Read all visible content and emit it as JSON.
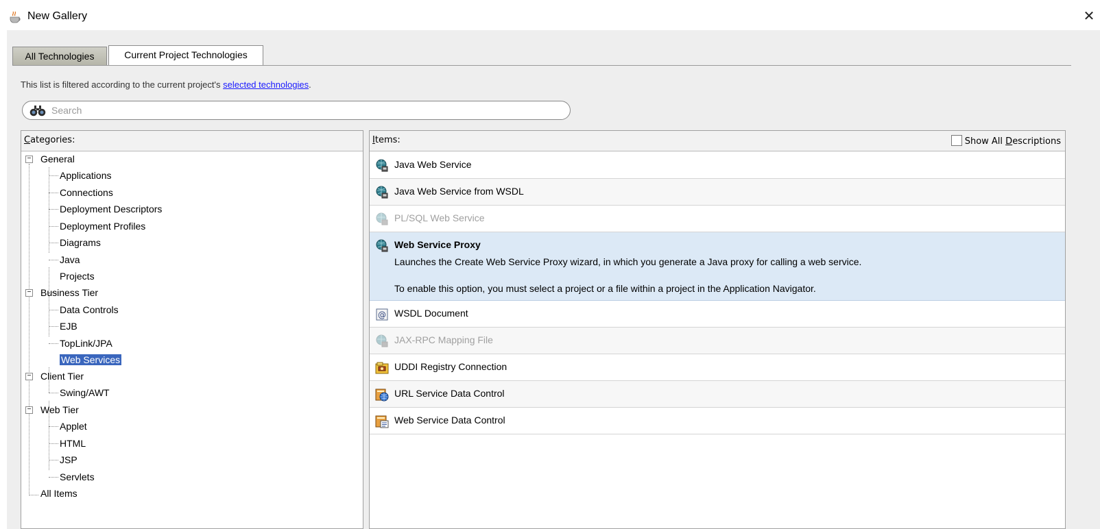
{
  "window": {
    "title": "New Gallery",
    "close_glyph": "✕",
    "app_icon": "java-cup-icon"
  },
  "tabs": [
    {
      "label": "All Technologies",
      "active": false
    },
    {
      "label": "Current Project Technologies",
      "active": true
    }
  ],
  "filter": {
    "text": "This list is filtered according to the current project's ",
    "link": "selected technologies",
    "suffix": "."
  },
  "search": {
    "placeholder": "Search",
    "value": "",
    "icon": "binoculars-icon"
  },
  "categories": {
    "header_first": "C",
    "header_rest": "ategories:",
    "groups": [
      {
        "label": "General",
        "children": [
          "Applications",
          "Connections",
          "Deployment Descriptors",
          "Deployment Profiles",
          "Diagrams",
          "Java",
          "Projects"
        ]
      },
      {
        "label": "Business Tier",
        "children": [
          "Data Controls",
          "EJB",
          "TopLink/JPA",
          "Web Services"
        ]
      },
      {
        "label": "Client Tier",
        "children": [
          "Swing/AWT"
        ]
      },
      {
        "label": "Web Tier",
        "children": [
          "Applet",
          "HTML",
          "JSP",
          "Servlets"
        ]
      }
    ],
    "all_items": "All Items",
    "selected": "Web Services"
  },
  "items": {
    "header_first": "I",
    "header_rest": "tems:",
    "show_all_prefix": "Show All ",
    "show_all_underlined": "D",
    "show_all_suffix": "escriptions",
    "show_all_checked": false,
    "list": [
      {
        "label": "Java Web Service",
        "icon": "web-service-icon",
        "disabled": false
      },
      {
        "label": "Java Web Service from WSDL",
        "icon": "web-service-icon",
        "disabled": false
      },
      {
        "label": "PL/SQL Web Service",
        "icon": "web-service-icon",
        "disabled": true
      },
      {
        "label": "Web Service Proxy",
        "icon": "web-service-icon",
        "disabled": false,
        "selected": true,
        "description": "Launches the Create Web Service Proxy wizard, in which you generate a Java proxy for calling a web service.",
        "note": "To enable this option, you must select a project or a file within a project in the Application Navigator."
      },
      {
        "label": "WSDL Document",
        "icon": "wsdl-document-icon",
        "disabled": false
      },
      {
        "label": "JAX-RPC Mapping File",
        "icon": "web-service-icon",
        "disabled": true
      },
      {
        "label": "UDDI Registry Connection",
        "icon": "uddi-registry-icon",
        "disabled": false
      },
      {
        "label": "URL Service Data Control",
        "icon": "url-data-control-icon",
        "disabled": false
      },
      {
        "label": "Web Service Data Control",
        "icon": "web-service-data-control-icon",
        "disabled": false
      }
    ]
  }
}
